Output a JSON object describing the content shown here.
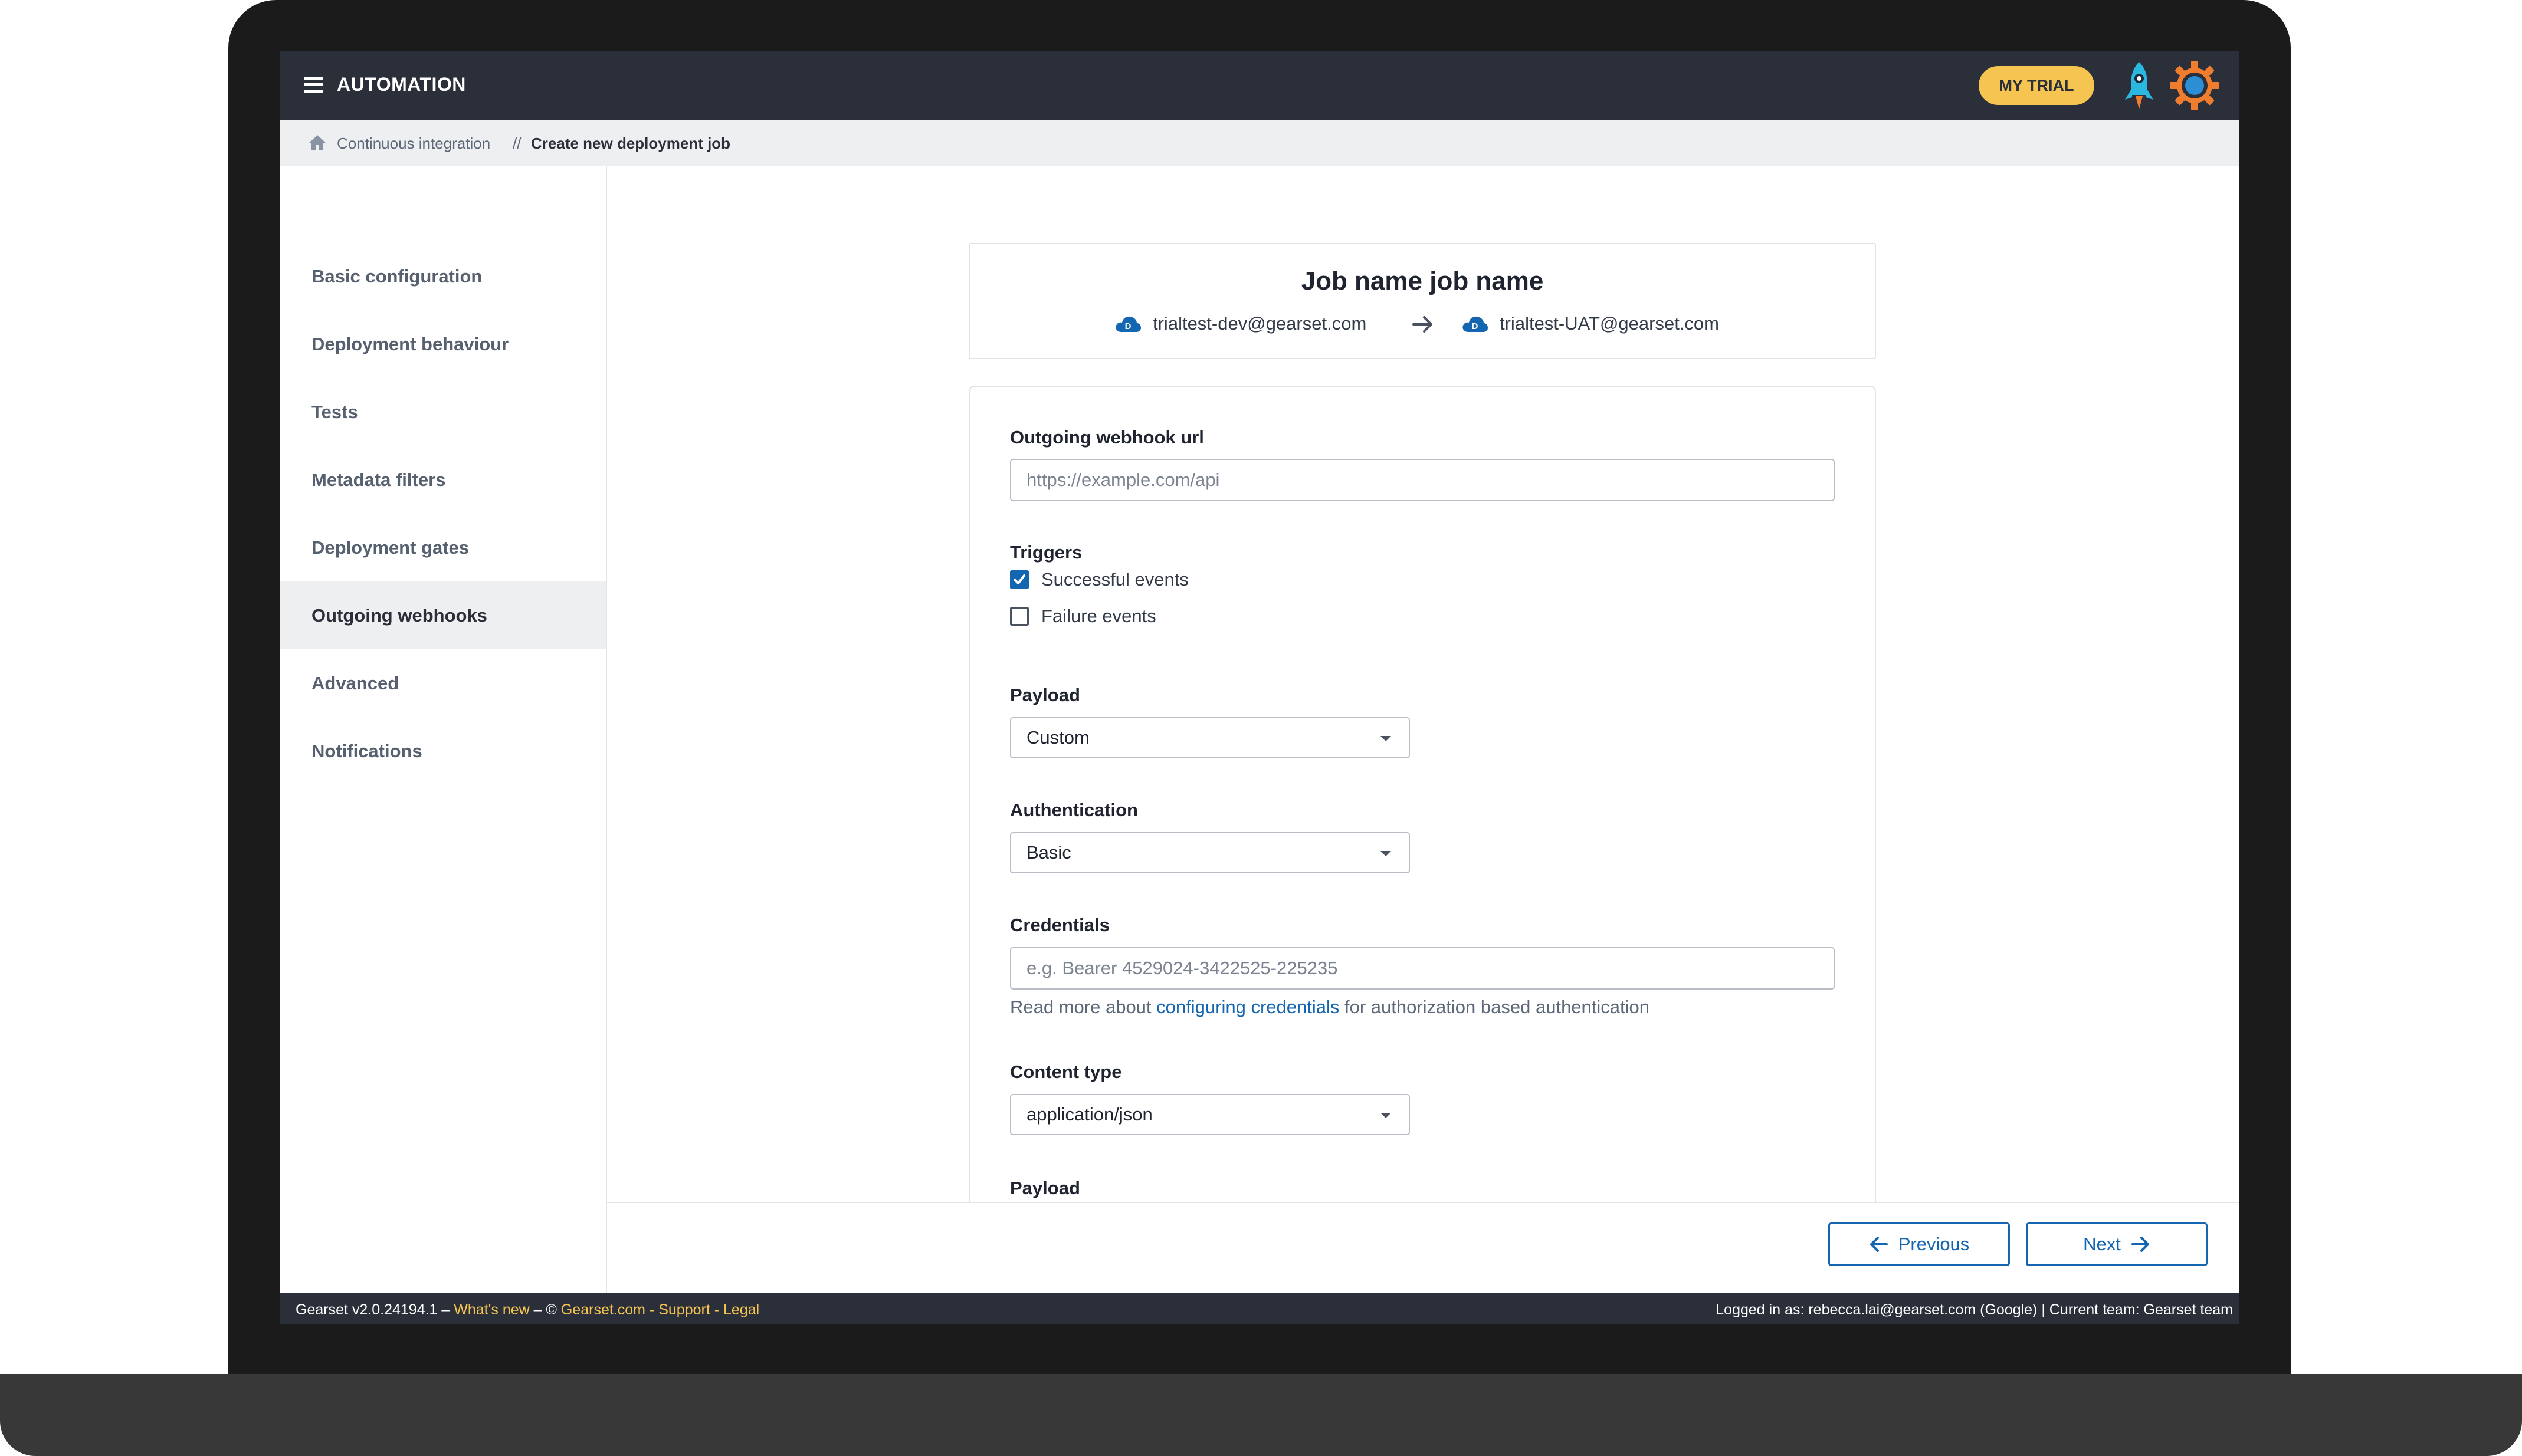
{
  "app": {
    "title": "AUTOMATION",
    "trial_label": "MY TRIAL"
  },
  "breadcrumb": {
    "parent": "Continuous integration",
    "separator": "//",
    "current": "Create new deployment job"
  },
  "sidebar": {
    "items": [
      {
        "label": "Basic configuration"
      },
      {
        "label": "Deployment behaviour"
      },
      {
        "label": "Tests"
      },
      {
        "label": "Metadata filters"
      },
      {
        "label": "Deployment gates"
      },
      {
        "label": "Outgoing webhooks",
        "active": true
      },
      {
        "label": "Advanced"
      },
      {
        "label": "Notifications"
      }
    ]
  },
  "job": {
    "title": "Job name job name",
    "source_org": "trialtest-dev@gearset.com",
    "target_org": "trialtest-UAT@gearset.com",
    "org_badge": "D"
  },
  "form": {
    "webhook_url": {
      "label": "Outgoing webhook url",
      "placeholder": "https://example.com/api"
    },
    "triggers": {
      "label": "Triggers",
      "options": [
        {
          "label": "Successful events",
          "checked": true
        },
        {
          "label": "Failure events",
          "checked": false
        }
      ]
    },
    "payload": {
      "label": "Payload",
      "value": "Custom"
    },
    "authentication": {
      "label": "Authentication",
      "value": "Basic"
    },
    "credentials": {
      "label": "Credentials",
      "placeholder": "e.g. Bearer 4529024-3422525-225235",
      "help_prefix": "Read more about",
      "help_link": "configuring credentials",
      "help_suffix": "for authorization based authentication"
    },
    "content_type": {
      "label": "Content type",
      "value": "application/json"
    },
    "payload2": {
      "label": "Payload"
    }
  },
  "nav": {
    "previous": "Previous",
    "next": "Next"
  },
  "footer": {
    "version": "Gearset v2.0.24194.1 –",
    "whats_new": "What's new",
    "dash_copy": "– ©",
    "site": "Gearset.com",
    "dash1": "-",
    "support": "Support",
    "dash2": "-",
    "legal": "Legal",
    "logged_in": "Logged in as: rebecca.lai@gearset.com (Google) | Current team: Gearset team"
  },
  "colors": {
    "topbar": "#2b2f3a",
    "accent": "#1466b0",
    "trial": "#f5c451",
    "rocket": "#2bb8e0",
    "gear": "#ef7d2d"
  },
  "icons": [
    "menu-icon",
    "rocket-icon",
    "gear-icon",
    "home-icon",
    "cloud-icon",
    "arrow-right-icon",
    "chevron-down-icon",
    "arrow-left-icon",
    "check-icon"
  ]
}
